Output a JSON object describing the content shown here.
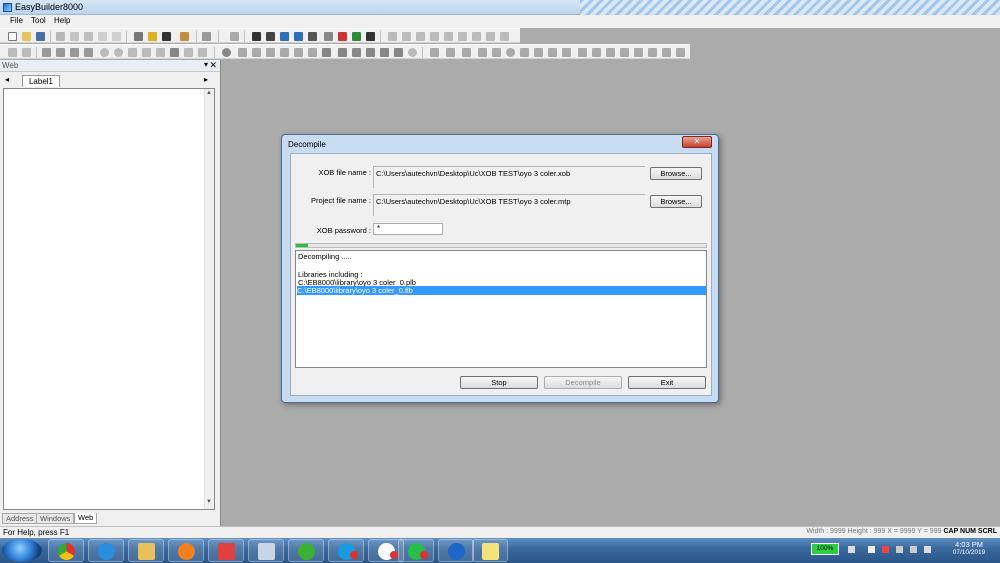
{
  "window": {
    "title": "EasyBuilder8000"
  },
  "menu": [
    "File",
    "Tool",
    "Help"
  ],
  "left_panel": {
    "header": "Web",
    "tab_label": "Label1",
    "bottom_tabs": [
      "Address",
      "Windows",
      "Web"
    ]
  },
  "dialog": {
    "title": "Decompile",
    "close_label": "✕",
    "xob_label": "XOB file name :",
    "xob_path": "C:\\Users\\autechvn\\Desktop\\Uc\\XOB TEST\\oyo 3 coler.xob",
    "project_label": "Project file name :",
    "project_path": "C:\\Users\\autechvn\\Desktop\\Uc\\XOB TEST\\oyo 3 coler.mtp",
    "browse_label": "Browse...",
    "password_label": "XOB password :",
    "password_value": "*",
    "progress_fraction": 0.03,
    "log": [
      "Decompiling .....",
      "",
      "Libraries including :",
      "C:\\EB8000\\library\\oyo 3 coler_0.plb",
      "C:\\EB8000\\library\\oyo 3 coler_0.flb"
    ],
    "buttons": {
      "stop": "Stop",
      "decompile": "Decompile",
      "exit": "Exit"
    }
  },
  "statusbar": {
    "help": "For Help, press F1",
    "info": "Width : 9999  Height : 999  X = 9999  Y = 999",
    "caps": "CAP  NUM  SCRL"
  },
  "taskbar": {
    "battery": "100%",
    "time": "4:03 PM",
    "date": "07/10/2019"
  }
}
